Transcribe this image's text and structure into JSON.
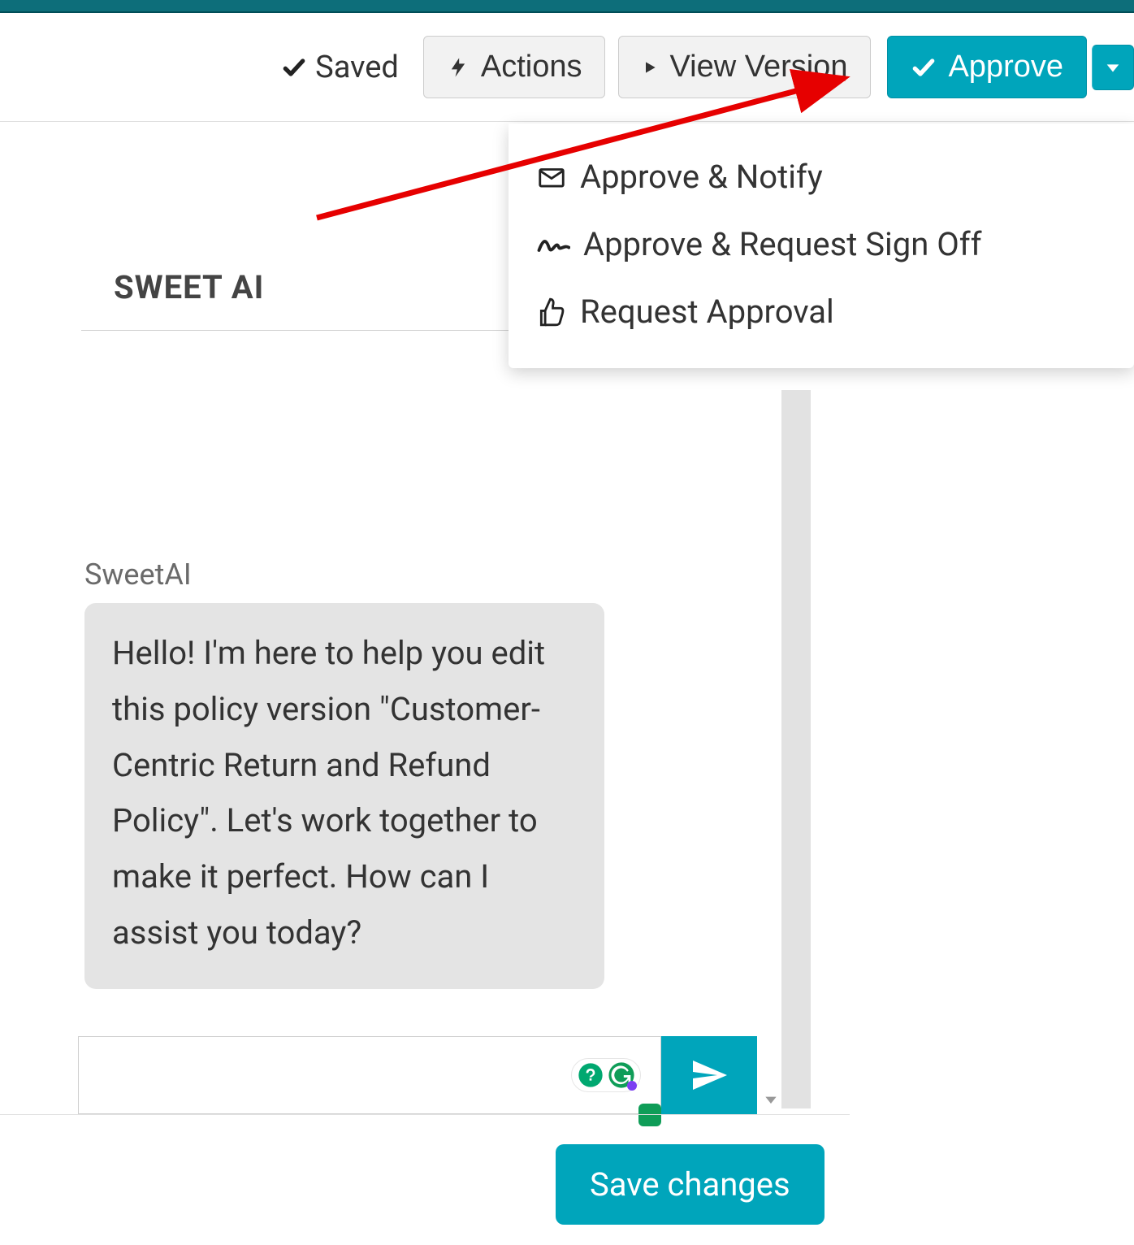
{
  "toolbar": {
    "saved_label": "Saved",
    "actions_label": "Actions",
    "view_version_label": "View Version",
    "approve_label": "Approve"
  },
  "dropdown": {
    "items": [
      {
        "label": "Approve & Notify",
        "icon": "mail-icon"
      },
      {
        "label": "Approve & Request Sign Off",
        "icon": "signature-icon"
      },
      {
        "label": "Request Approval",
        "icon": "thumbs-up-icon"
      }
    ]
  },
  "section": {
    "title": "SWEET AI"
  },
  "chat": {
    "sender": "SweetAI",
    "message": "Hello! I'm here to help you edit this policy version \"Customer-Centric Return and Refund Policy\". Let's work together to make it perfect. How can I assist you today?",
    "input_placeholder": ""
  },
  "footer": {
    "save_changes_label": "Save changes"
  },
  "colors": {
    "accent": "#00a5bb",
    "dark_teal": "#0d6e7a"
  }
}
